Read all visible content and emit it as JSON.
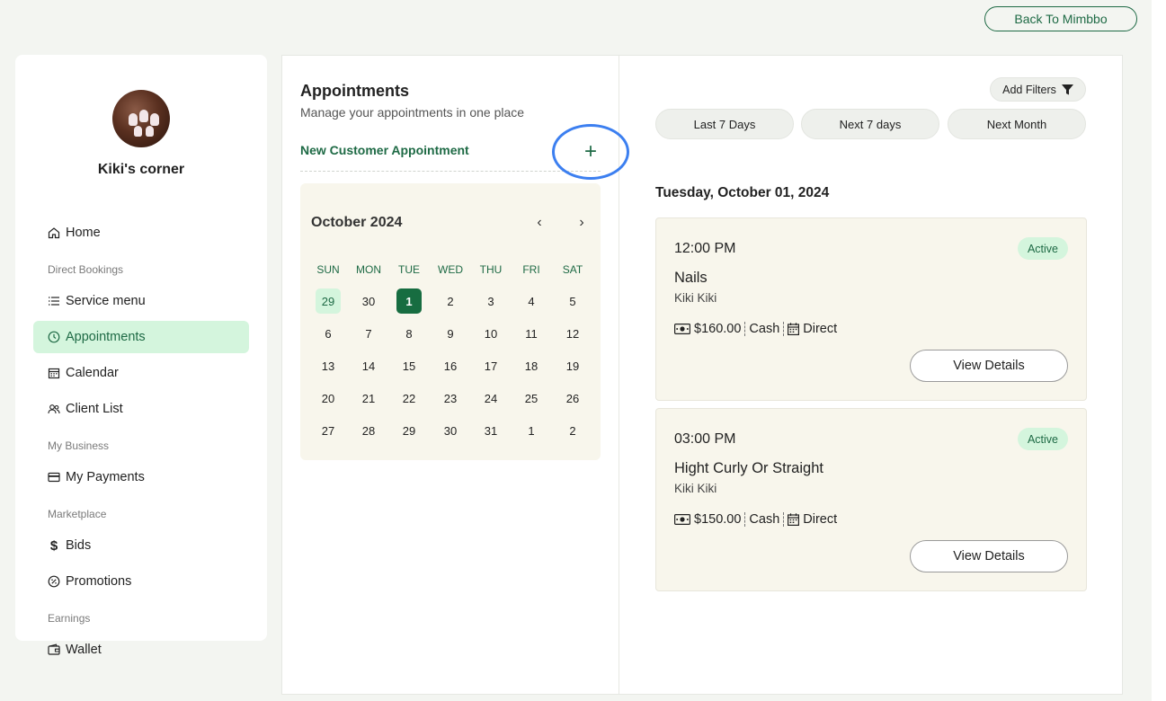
{
  "header": {
    "back_label": "Back To Mimbbo"
  },
  "sidebar": {
    "shop_name": "Kiki's corner",
    "home": "Home",
    "section_direct": "Direct Bookings",
    "service_menu": "Service menu",
    "appointments": "Appointments",
    "calendar": "Calendar",
    "client_list": "Client List",
    "section_business": "My Business",
    "payments": "My Payments",
    "section_marketplace": "Marketplace",
    "bids": "Bids",
    "promotions": "Promotions",
    "section_earnings": "Earnings",
    "wallet": "Wallet"
  },
  "appointments": {
    "title": "Appointments",
    "subtitle": "Manage your appointments in one place",
    "new_label": "New Customer Appointment",
    "new_icon": "+"
  },
  "calendar": {
    "month": "October 2024",
    "prev_icon": "‹",
    "next_icon": "›",
    "dow": [
      "SUN",
      "MON",
      "TUE",
      "WED",
      "THU",
      "FRI",
      "SAT"
    ],
    "days": [
      "29",
      "30",
      "1",
      "2",
      "3",
      "4",
      "5",
      "6",
      "7",
      "8",
      "9",
      "10",
      "11",
      "12",
      "13",
      "14",
      "15",
      "16",
      "17",
      "18",
      "19",
      "20",
      "21",
      "22",
      "23",
      "24",
      "25",
      "26",
      "27",
      "28",
      "29",
      "30",
      "31",
      "1",
      "2"
    ],
    "today_index": 0,
    "selected_index": 2
  },
  "filters": {
    "add_label": "Add Filters",
    "ranges": [
      "Last 7 Days",
      "Next 7 days",
      "Next Month"
    ]
  },
  "schedule": {
    "date": "Tuesday, October 01, 2024",
    "cards": [
      {
        "time": "12:00 PM",
        "status": "Active",
        "service": "Nails",
        "client": "Kiki Kiki",
        "price": "$160.00",
        "payment": "Cash",
        "source": "Direct",
        "button": "View Details"
      },
      {
        "time": "03:00 PM",
        "status": "Active",
        "service": "Hight Curly Or Straight",
        "client": "Kiki Kiki",
        "price": "$150.00",
        "payment": "Cash",
        "source": "Direct",
        "button": "View Details"
      }
    ]
  },
  "colors": {
    "brand": "#1e6a45",
    "active_bg": "#d4f5dd",
    "highlight_ring": "#3c7ff0"
  }
}
